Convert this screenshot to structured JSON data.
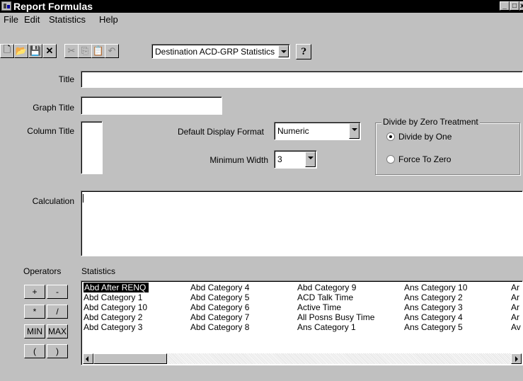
{
  "window": {
    "title": "Report Formulas",
    "controls": {
      "minimize": "_",
      "maximize": "□",
      "close": "x"
    }
  },
  "menu": {
    "items": [
      {
        "label": "File"
      },
      {
        "label": "Edit"
      },
      {
        "label": "Statistics"
      },
      {
        "label": "Help"
      }
    ]
  },
  "toolbar": {
    "buttons": [
      {
        "icon": "new-file-icon",
        "glyph": "🗋"
      },
      {
        "icon": "open-folder-icon",
        "glyph": "📂"
      },
      {
        "icon": "save-icon",
        "glyph": "💾"
      },
      {
        "icon": "delete-icon",
        "glyph": "✕"
      },
      {
        "icon": "cut-icon",
        "glyph": "✂"
      },
      {
        "icon": "copy-icon",
        "glyph": "⎘"
      },
      {
        "icon": "paste-icon",
        "glyph": "📋"
      },
      {
        "icon": "undo-icon",
        "glyph": "↶"
      },
      {
        "icon": "help-icon",
        "glyph": "?"
      }
    ],
    "destination_select": "Destination ACD-GRP Statistics"
  },
  "form": {
    "title_label": "Title",
    "title_value": "",
    "graph_title_label": "Graph Title",
    "graph_title_value": "",
    "column_title_label": "Column Title",
    "column_title_value": "",
    "default_display_format_label": "Default Display Format",
    "default_display_format_value": "Numeric",
    "minimum_width_label": "Minimum Width",
    "minimum_width_value": "3",
    "calculation_label": "Calculation",
    "calculation_value": ""
  },
  "divide_by_zero": {
    "group_label": "Divide by Zero Treatment",
    "options": [
      {
        "label": "Divide by One",
        "selected": true
      },
      {
        "label": "Force To Zero",
        "selected": false
      }
    ]
  },
  "operators": {
    "label": "Operators",
    "buttons": [
      "+",
      "-",
      "*",
      "/",
      "MIN",
      "MAX",
      "(",
      ")"
    ]
  },
  "statistics": {
    "label": "Statistics",
    "columns": [
      [
        "Abd After RENQ",
        "Abd Category 1",
        "Abd Category 10",
        "Abd Category 2",
        "Abd Category 3"
      ],
      [
        "Abd Category 4",
        "Abd Category 5",
        "Abd Category 6",
        "Abd Category 7",
        "Abd Category 8"
      ],
      [
        "Abd Category 9",
        "ACD Talk Time",
        "Active Time",
        "All Posns Busy Time",
        "Ans Category 1"
      ],
      [
        "Ans Category 10",
        "Ans Category 2",
        "Ans Category 3",
        "Ans Category 4",
        "Ans Category 5"
      ],
      [
        "Ar",
        "Ar",
        "Ar",
        "Ar",
        "Av"
      ]
    ],
    "selected": "Abd After RENQ"
  }
}
